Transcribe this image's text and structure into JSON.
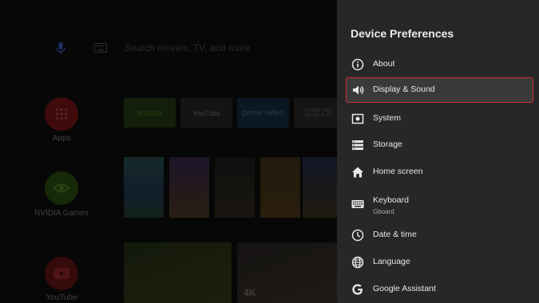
{
  "home": {
    "search_placeholder": "Search movies, TV, and more",
    "apps_row": [
      {
        "label": "Apps"
      },
      {
        "label": "NVIDIA Games"
      },
      {
        "label": "YouTube"
      }
    ],
    "tiles": [
      {
        "label": "NVIDIA"
      },
      {
        "label": "YouTube"
      },
      {
        "label": "prime video"
      },
      {
        "label": "Google Play Movies & TV"
      }
    ],
    "video_badge": "4K"
  },
  "panel": {
    "title": "Device Preferences",
    "items": [
      {
        "label": "About",
        "icon": "info-icon"
      },
      {
        "label": "Display & Sound",
        "icon": "speaker-icon",
        "selected": true
      },
      {
        "label": "System",
        "icon": "system-icon"
      },
      {
        "label": "Storage",
        "icon": "storage-icon"
      },
      {
        "label": "Home screen",
        "icon": "home-icon"
      },
      {
        "label": "Keyboard",
        "sub": "Gboard",
        "icon": "keyboard-icon"
      },
      {
        "label": "Date & time",
        "icon": "clock-icon"
      },
      {
        "label": "Language",
        "icon": "globe-icon"
      },
      {
        "label": "Google Assistant",
        "icon": "google-icon"
      }
    ],
    "accent_color": "#d02d33"
  }
}
